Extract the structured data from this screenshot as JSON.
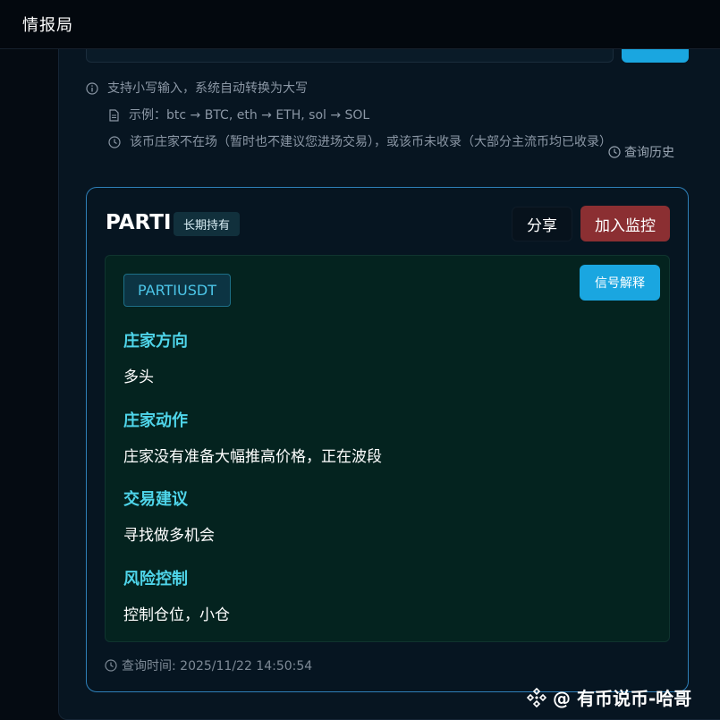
{
  "header": {
    "title": "情报局"
  },
  "hints": {
    "lowercase": "支持小写输入，系统自动转换为大写",
    "example": "示例：btc → BTC, eth → ETH, sol → SOL",
    "warning": "该币庄家不在场（暂时也不建议您进场交易），或该币未收录（大部分主流币均已收录）",
    "history_link": "查询历史"
  },
  "result": {
    "coin": "PARTI",
    "badge": "长期持有",
    "share_label": "分享",
    "monitor_label": "加入监控",
    "symbol": "PARTIUSDT",
    "signal_label": "信号解释",
    "sections": [
      {
        "title": "庄家方向",
        "value": "多头"
      },
      {
        "title": "庄家动作",
        "value": "庄家没有准备大幅推高价格，正在波段"
      },
      {
        "title": "交易建议",
        "value": "寻找做多机会"
      },
      {
        "title": "风险控制",
        "value": "控制仓位，小仓"
      }
    ],
    "query_time": "查询时间: 2025/11/22 14:50:54"
  },
  "watermark": "@ 有币说币-哈哥",
  "colors": {
    "accent": "#1aa6e0",
    "monitor": "#8b2f32",
    "section_title": "#4fd5ea",
    "card_border": "#2e7fb8"
  }
}
